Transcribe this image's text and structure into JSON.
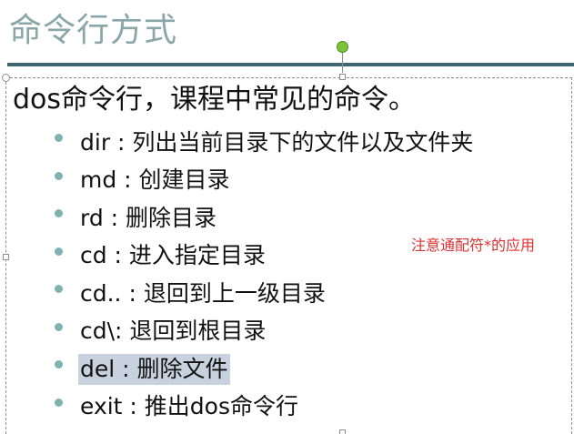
{
  "slide": {
    "title": "命令行方式",
    "heading": "dos命令行，课程中常见的命令。",
    "bullets": [
      {
        "text": "dir : 列出当前目录下的文件以及文件夹",
        "highlighted": false
      },
      {
        "text": "md : 创建目录",
        "highlighted": false
      },
      {
        "text": "rd : 删除目录",
        "highlighted": false
      },
      {
        "text": "cd : 进入指定目录",
        "highlighted": false
      },
      {
        "text": "cd.. : 退回到上一级目录",
        "highlighted": false
      },
      {
        "text": "cd\\: 退回到根目录",
        "highlighted": false
      },
      {
        "text": "del : 删除文件",
        "highlighted": true
      },
      {
        "text": "exit : 推出dos命令行",
        "highlighted": false
      }
    ],
    "annotation": "注意通配符*的应用"
  },
  "colors": {
    "title": "#8aa6a8",
    "title_rule": "#3e6670",
    "bullet": "#7fb3b3",
    "annotation": "#e03030",
    "highlight": "#c8d2de",
    "rotation_handle": "#7cc33a"
  },
  "icons": {
    "rotation_handle": "rotate-handle-icon",
    "resize_handle": "resize-handle-icon"
  }
}
